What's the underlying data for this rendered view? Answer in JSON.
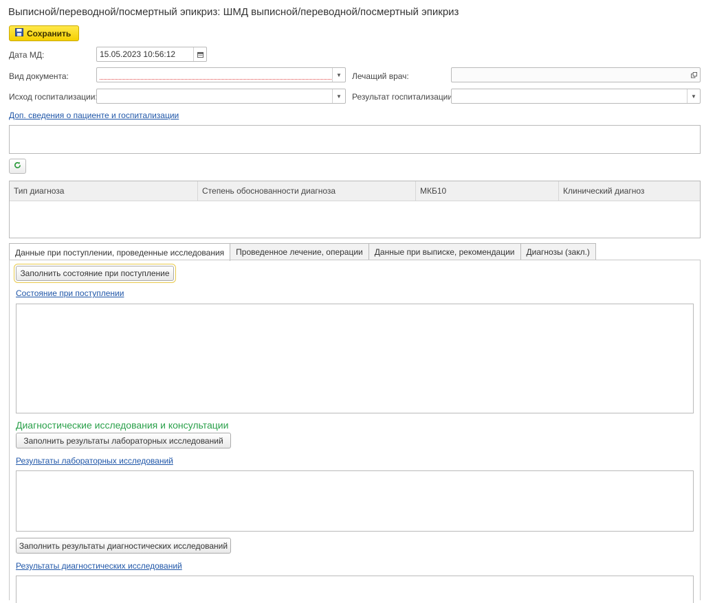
{
  "window": {
    "title": "Выписной/переводной/посмертный эпикриз: ШМД выписной/переводной/посмертный эпикриз"
  },
  "toolbar": {
    "save_label": "Сохранить"
  },
  "form": {
    "date_label": "Дата МД:",
    "date_value": "15.05.2023 10:56:12",
    "doc_type_label": "Вид документа:",
    "doc_type_value": "",
    "doctor_label": "Лечащий врач:",
    "doctor_value": "",
    "outcome_label": "Исход госпитализации:",
    "outcome_value": "",
    "result_label": "Результат госпитализации:",
    "result_value": "",
    "extra_link": "Доп. сведения о пациенте и госпитализации"
  },
  "diagnosis_table": {
    "columns": [
      "Тип диагноза",
      "Степень обоснованности диагноза",
      "МКБ10",
      "Клинический диагноз"
    ]
  },
  "tabs": [
    {
      "label": "Данные при поступлении, проведенные исследования",
      "active": true
    },
    {
      "label": "Проведенное лечение, операции",
      "active": false
    },
    {
      "label": "Данные при выписке, рекомендации",
      "active": false
    },
    {
      "label": "Диагнозы (закл.)",
      "active": false
    }
  ],
  "admission": {
    "fill_button": "Заполнить состояние при поступление",
    "state_link": "Состояние при поступлении"
  },
  "diagnostics": {
    "section_title": "Диагностические исследования и консультации",
    "fill_lab_button": "Заполнить результаты лабораторных исследований",
    "lab_link": "Результаты лабораторных исследований",
    "fill_diag_button": "Заполнить результаты диагностических исследований",
    "diag_link": "Результаты диагностических исследований"
  },
  "colors": {
    "accent_yellow": "#f5d000",
    "link_blue": "#1f56a8",
    "section_green": "#2aa04a"
  }
}
